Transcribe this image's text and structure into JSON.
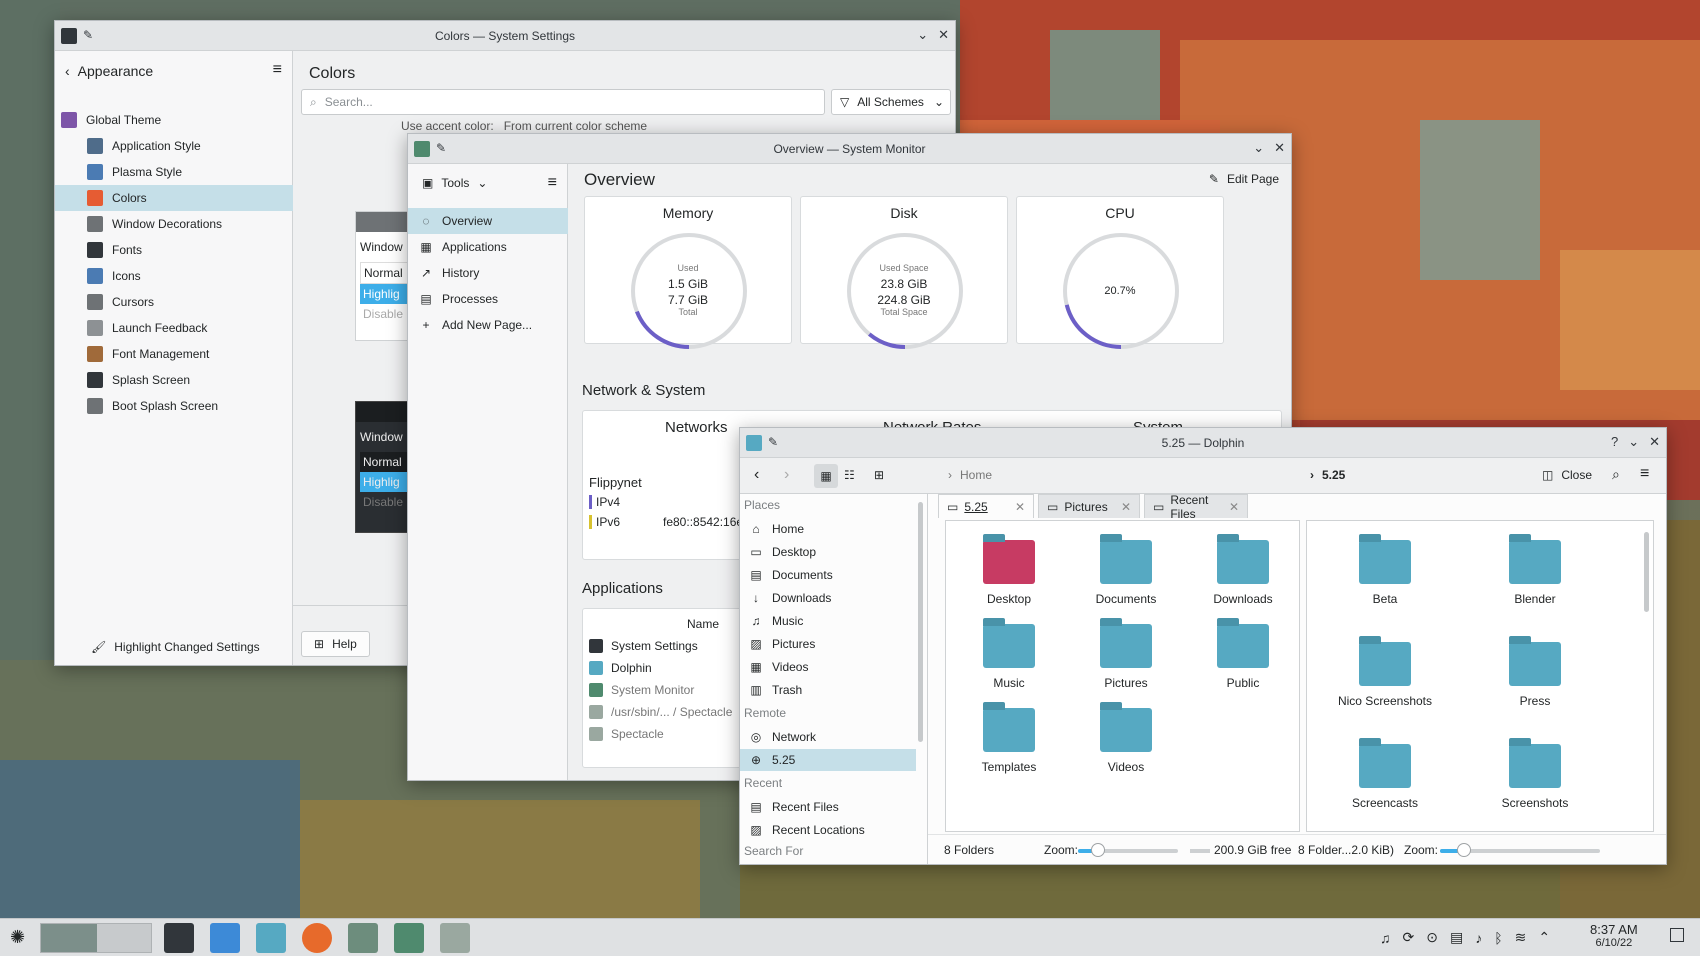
{
  "colors": {
    "accent": "#3daee9",
    "selection": "#c5dfe8",
    "window": "#eff0f1",
    "gauge": "#6c5fc7",
    "folder": "#56a9c2"
  },
  "settings": {
    "title": "Colors — System Settings",
    "back_label": "Appearance",
    "page_title": "Colors",
    "search_placeholder": "Search...",
    "schemes_label": "All Schemes",
    "accent_row": "Use accent color:   From current color scheme",
    "items": [
      {
        "label": "Global Theme",
        "icon": "global-theme-icon"
      },
      {
        "label": "Application Style",
        "icon": "application-style-icon"
      },
      {
        "label": "Plasma Style",
        "icon": "plasma-style-icon"
      },
      {
        "label": "Colors",
        "icon": "colors-icon"
      },
      {
        "label": "Window Decorations",
        "icon": "window-decorations-icon"
      },
      {
        "label": "Fonts",
        "icon": "fonts-icon"
      },
      {
        "label": "Icons",
        "icon": "icons-icon"
      },
      {
        "label": "Cursors",
        "icon": "cursors-icon"
      },
      {
        "label": "Launch Feedback",
        "icon": "launch-feedback-icon"
      },
      {
        "label": "Font Management",
        "icon": "font-management-icon"
      },
      {
        "label": "Splash Screen",
        "icon": "splash-screen-icon"
      },
      {
        "label": "Boot Splash Screen",
        "icon": "boot-splash-icon"
      }
    ],
    "preview1": {
      "title": "Window",
      "rows": [
        "Normal",
        "Highlig",
        "Disable"
      ]
    },
    "preview2": {
      "title": "Window",
      "rows": [
        "Normal",
        "Highlig",
        "Disable"
      ]
    },
    "highlight_btn": "Highlight Changed Settings",
    "help_btn": "Help"
  },
  "monitor": {
    "title": "Overview — System Monitor",
    "tools_label": "Tools",
    "nav": [
      "Overview",
      "Applications",
      "History",
      "Processes",
      "Add New Page..."
    ],
    "page_title": "Overview",
    "edit_page": "Edit Page",
    "memory": {
      "title": "Memory",
      "top": "Used",
      "used": "1.5 GiB",
      "total": "7.7 GiB",
      "bottom": "Total",
      "fraction": 0.19
    },
    "disk": {
      "title": "Disk",
      "top": "Used Space",
      "used": "23.8 GiB",
      "total": "224.8 GiB",
      "bottom": "Total Space",
      "fraction": 0.11
    },
    "cpu": {
      "title": "CPU",
      "value": "20.7%",
      "fraction": 0.21
    },
    "net_section": "Network & System",
    "networks_title": "Networks",
    "netrates_title": "Network Rates",
    "system_title": "System",
    "net_name": "Flippynet",
    "ipv4": "IPv4",
    "ipv6": "IPv6",
    "ipv6_value": "fe80::8542:16e",
    "apps_section": "Applications",
    "name_col": "Name",
    "apps": [
      "System Settings",
      "Dolphin",
      "System Monitor",
      "/usr/sbin/... / Spectacle",
      "Spectacle"
    ]
  },
  "dolphin": {
    "title": "5.25 — Dolphin",
    "crumb_home": "Home",
    "crumb_current": "5.25",
    "close_label": "Close",
    "tabs": [
      "5.25",
      "Pictures",
      "Recent Files"
    ],
    "places_header": "Places",
    "places": [
      {
        "label": "Home",
        "icon": "home-icon"
      },
      {
        "label": "Desktop",
        "icon": "desktop-icon"
      },
      {
        "label": "Documents",
        "icon": "documents-icon"
      },
      {
        "label": "Downloads",
        "icon": "downloads-icon"
      },
      {
        "label": "Music",
        "icon": "music-icon"
      },
      {
        "label": "Pictures",
        "icon": "pictures-icon"
      },
      {
        "label": "Videos",
        "icon": "videos-icon"
      },
      {
        "label": "Trash",
        "icon": "trash-icon"
      }
    ],
    "remote_header": "Remote",
    "remote": [
      {
        "label": "Network",
        "icon": "network-icon"
      },
      {
        "label": "5.25",
        "icon": "globe-icon"
      }
    ],
    "recent_header": "Recent",
    "recent": [
      {
        "label": "Recent Files",
        "icon": "recent-files-icon"
      },
      {
        "label": "Recent Locations",
        "icon": "recent-locations-icon"
      }
    ],
    "search_header": "Search For",
    "left_folders": [
      "Desktop",
      "Documents",
      "Downloads",
      "Music",
      "Pictures",
      "Public",
      "Templates",
      "Videos"
    ],
    "right_folders": [
      "Beta",
      "Blender",
      "Nico Screenshots",
      "Press",
      "Screencasts",
      "Screenshots"
    ],
    "status_left": "8 Folders",
    "zoom_label": "Zoom:",
    "free_space": "200.9 GiB free",
    "status_right": "8 Folder...2.0 KiB)",
    "zoom_left": 0.2,
    "zoom_right": 0.15
  },
  "taskbar": {
    "time": "8:37 AM",
    "date": "6/10/22"
  }
}
